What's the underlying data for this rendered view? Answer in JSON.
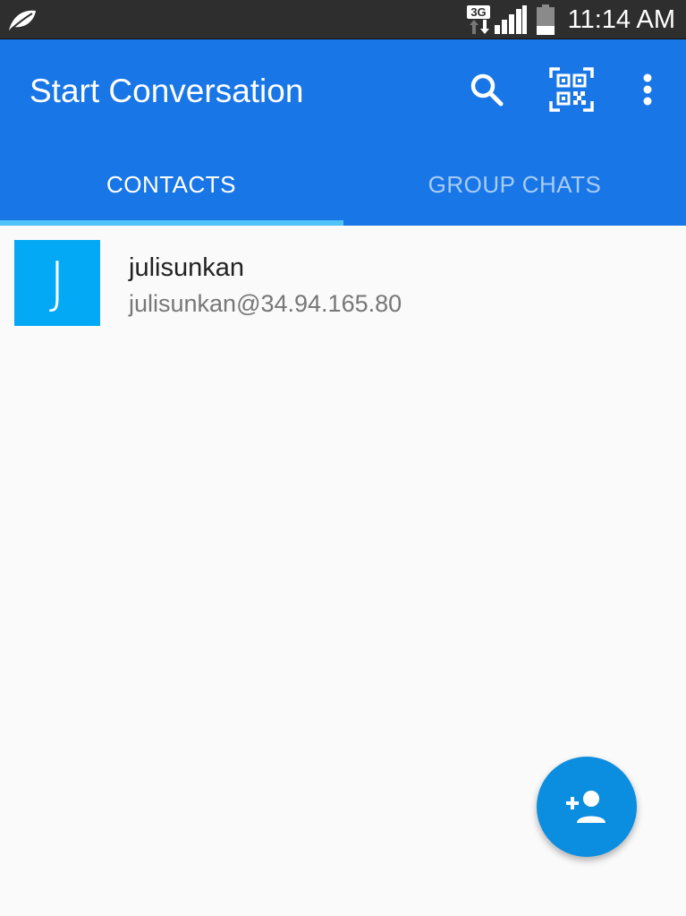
{
  "status_bar": {
    "network_type": "3G",
    "time": "11:14 AM",
    "icons": [
      "leaf-icon",
      "network-3g-icon",
      "signal-icon",
      "battery-icon"
    ]
  },
  "app_bar": {
    "title": "Start Conversation",
    "actions": [
      "search-icon",
      "qr-code-icon",
      "more-vert-icon"
    ],
    "color": "#1976e6"
  },
  "tabs": [
    {
      "label": "CONTACTS",
      "selected": true
    },
    {
      "label": "GROUP CHATS",
      "selected": false
    }
  ],
  "contacts": [
    {
      "avatar_letter": "J",
      "name": "julisunkan",
      "jid": "julisunkan@34.94.165.80",
      "avatar_color": "#03a9f4"
    }
  ],
  "fab": {
    "icon": "person-add-icon",
    "color": "#0b8de0"
  }
}
